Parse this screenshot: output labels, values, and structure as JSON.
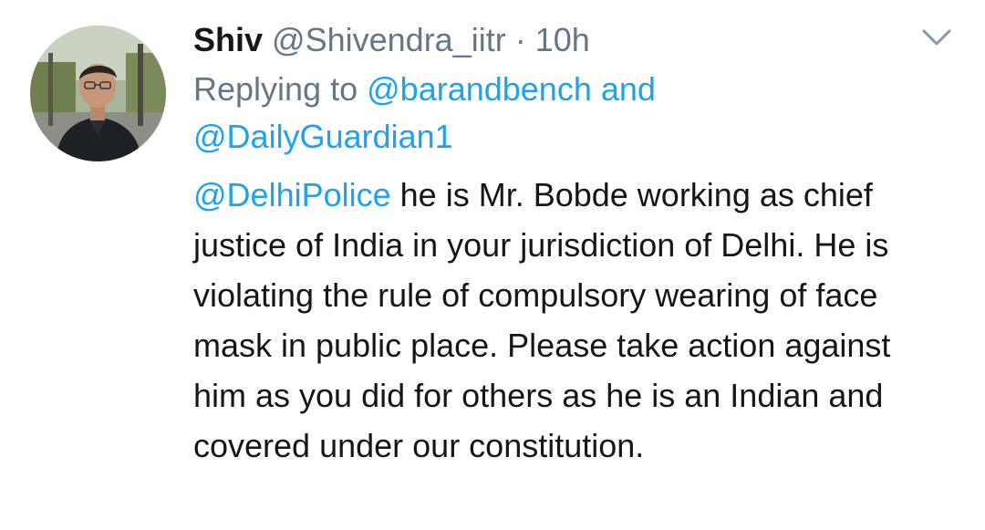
{
  "tweet": {
    "author_name": "Shiv",
    "author_handle": "@Shivendra_iitr",
    "separator": "·",
    "timestamp": "10h",
    "replying_prefix": "Replying to",
    "reply_mention_1": "@barandbench",
    "reply_and": "and",
    "reply_mention_2": "@DailyGuardian1",
    "body_mention": "@DelhiPolice",
    "body_text": "he is Mr. Bobde working as chief justice of India in your jurisdiction of Delhi. He is violating the rule of compulsory wearing of face mask in public place. Please take action against him as you did for others as he is an Indian and covered under our constitution."
  },
  "icons": {
    "menu": "chevron-down-icon",
    "avatar": "profile-photo"
  },
  "colors": {
    "link": "#1da1f2",
    "secondary_text": "#657786",
    "primary_text": "#14171a",
    "background": "#ffffff"
  }
}
